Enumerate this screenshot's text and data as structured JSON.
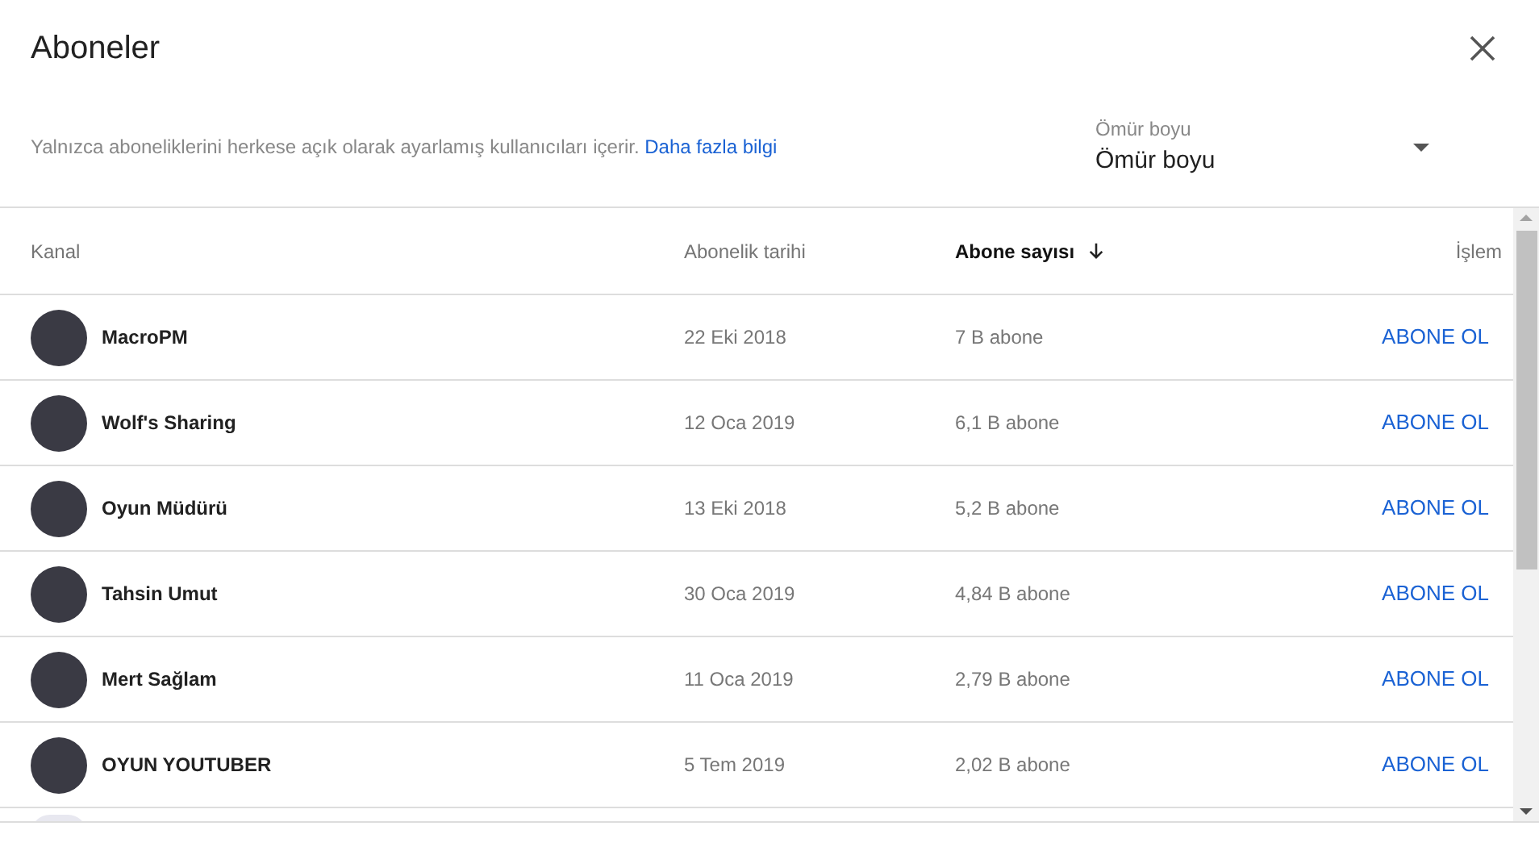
{
  "dialog": {
    "title": "Aboneler",
    "description": "Yalnızca aboneliklerini herkese açık olarak ayarlamış kullanıcıları içerir.",
    "link": "Daha fazla bilgi"
  },
  "period_select": {
    "label": "Ömür boyu",
    "value": "Ömür boyu"
  },
  "table": {
    "columns": [
      {
        "label": "Kanal",
        "sorted": false
      },
      {
        "label": "Abonelik tarihi",
        "sorted": false
      },
      {
        "label": "Abone sayısı",
        "sorted": true
      },
      {
        "label": "İşlem",
        "sorted": false
      }
    ],
    "rows": [
      {
        "channel": "MacroPM",
        "date": "22 Eki 2018",
        "subscribers": "7 B abone",
        "action": "ABONE OL"
      },
      {
        "channel": "Wolf's Sharing",
        "date": "12 Oca 2019",
        "subscribers": "6,1 B abone",
        "action": "ABONE OL"
      },
      {
        "channel": "Oyun Müdürü",
        "date": "13 Eki 2018",
        "subscribers": "5,2 B abone",
        "action": "ABONE OL"
      },
      {
        "channel": "Tahsin Umut",
        "date": "30 Oca 2019",
        "subscribers": "4,84 B abone",
        "action": "ABONE OL"
      },
      {
        "channel": "Mert Sağlam",
        "date": "11 Oca 2019",
        "subscribers": "2,79 B abone",
        "action": "ABONE OL"
      },
      {
        "channel": "OYUN YOUTUBER",
        "date": "5 Tem 2019",
        "subscribers": "2,02 B abone",
        "action": "ABONE OL"
      }
    ]
  }
}
